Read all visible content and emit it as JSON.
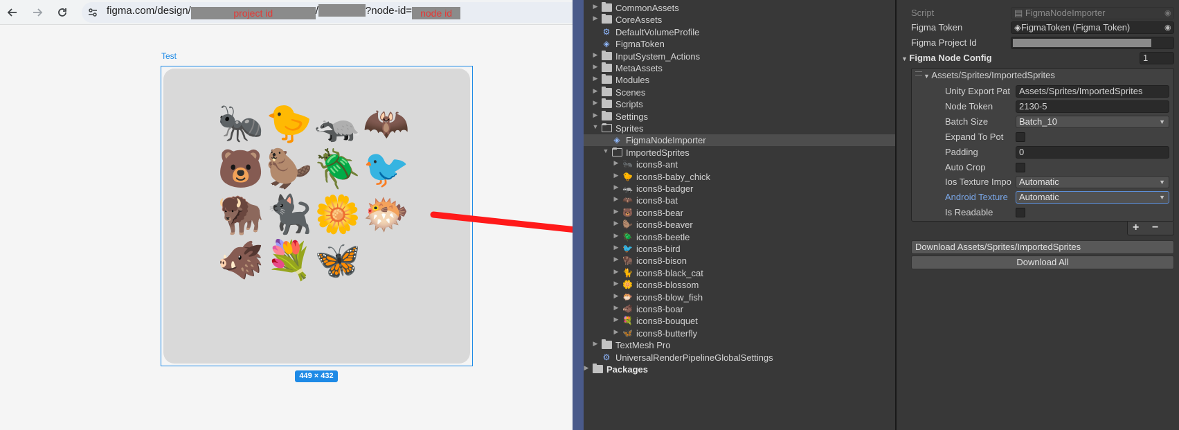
{
  "browser": {
    "url_prefix": "figma.com/design/",
    "url_project_id": "project id",
    "url_slash": "/",
    "url_query": "?node-id=",
    "url_node_id": "node id",
    "frame_label": "Test",
    "size_badge": "449 × 432",
    "emojis": [
      "🐜",
      "🐤",
      "🦡",
      "🦇",
      "🐻",
      "🦫",
      "🪲",
      "🐦",
      "🦬",
      "🐈‍⬛",
      "🌼",
      "🐡",
      "🐗",
      "💐",
      "🦋"
    ]
  },
  "tree": {
    "rows": [
      {
        "label": "CommonAssets",
        "kind": "folder",
        "depth": 1,
        "expanded": false
      },
      {
        "label": "CoreAssets",
        "kind": "folder",
        "depth": 1,
        "expanded": false
      },
      {
        "label": "DefaultVolumeProfile",
        "kind": "asset",
        "icon": "⚙",
        "depth": 1
      },
      {
        "label": "FigmaToken",
        "kind": "asset",
        "icon": "◈",
        "depth": 1
      },
      {
        "label": "InputSystem_Actions",
        "kind": "folder",
        "depth": 1,
        "expanded": false
      },
      {
        "label": "MetaAssets",
        "kind": "folder",
        "depth": 1,
        "expanded": false
      },
      {
        "label": "Modules",
        "kind": "folder",
        "depth": 1,
        "expanded": false
      },
      {
        "label": "Scenes",
        "kind": "folder",
        "depth": 1,
        "expanded": false
      },
      {
        "label": "Scripts",
        "kind": "folder",
        "depth": 1,
        "expanded": false
      },
      {
        "label": "Settings",
        "kind": "folder",
        "depth": 1,
        "expanded": false
      },
      {
        "label": "Sprites",
        "kind": "folder",
        "depth": 1,
        "expanded": true
      },
      {
        "label": "FigmaNodeImporter",
        "kind": "asset",
        "icon": "◈",
        "depth": 2,
        "selected": true
      },
      {
        "label": "ImportedSprites",
        "kind": "folder",
        "depth": 2,
        "expanded": true
      },
      {
        "label": "icons8-ant",
        "kind": "sprite",
        "icon": "🐜",
        "depth": 3
      },
      {
        "label": "icons8-baby_chick",
        "kind": "sprite",
        "icon": "🐤",
        "depth": 3
      },
      {
        "label": "icons8-badger",
        "kind": "sprite",
        "icon": "🦡",
        "depth": 3
      },
      {
        "label": "icons8-bat",
        "kind": "sprite",
        "icon": "🦇",
        "depth": 3
      },
      {
        "label": "icons8-bear",
        "kind": "sprite",
        "icon": "🐻",
        "depth": 3
      },
      {
        "label": "icons8-beaver",
        "kind": "sprite",
        "icon": "🦫",
        "depth": 3
      },
      {
        "label": "icons8-beetle",
        "kind": "sprite",
        "icon": "🪲",
        "depth": 3
      },
      {
        "label": "icons8-bird",
        "kind": "sprite",
        "icon": "🐦",
        "depth": 3
      },
      {
        "label": "icons8-bison",
        "kind": "sprite",
        "icon": "🦬",
        "depth": 3
      },
      {
        "label": "icons8-black_cat",
        "kind": "sprite",
        "icon": "🐈",
        "depth": 3
      },
      {
        "label": "icons8-blossom",
        "kind": "sprite",
        "icon": "🌼",
        "depth": 3
      },
      {
        "label": "icons8-blow_fish",
        "kind": "sprite",
        "icon": "🐡",
        "depth": 3
      },
      {
        "label": "icons8-boar",
        "kind": "sprite",
        "icon": "🐗",
        "depth": 3
      },
      {
        "label": "icons8-bouquet",
        "kind": "sprite",
        "icon": "💐",
        "depth": 3
      },
      {
        "label": "icons8-butterfly",
        "kind": "sprite",
        "icon": "🦋",
        "depth": 3
      },
      {
        "label": "TextMesh Pro",
        "kind": "folder",
        "depth": 1,
        "expanded": false
      },
      {
        "label": "UniversalRenderPipelineGlobalSettings",
        "kind": "asset",
        "icon": "⚙",
        "depth": 1
      },
      {
        "label": "Packages",
        "kind": "folder",
        "depth": 0,
        "expanded": false,
        "bold": true
      }
    ]
  },
  "inspector": {
    "script_label": "Script",
    "script_value": "FigmaNodeImporter",
    "token_label": "Figma Token",
    "token_value": "FigmaToken (Figma Token)",
    "project_label": "Figma Project Id",
    "config_label": "Figma Node Config",
    "config_count": "1",
    "element_label": "Assets/Sprites/ImportedSprites",
    "unity_export_label": "Unity Export Pat",
    "unity_export_value": "Assets/Sprites/ImportedSprites",
    "node_token_label": "Node Token",
    "node_token_value": "2130-5",
    "batch_size_label": "Batch Size",
    "batch_size_value": "Batch_10",
    "expand_label": "Expand To Pot",
    "padding_label": "Padding",
    "padding_value": "0",
    "autocrop_label": "Auto Crop",
    "ios_label": "Ios Texture Impo",
    "ios_value": "Automatic",
    "android_label": "Android Texture",
    "android_value": "Automatic",
    "readable_label": "Is Readable",
    "add_label": "+",
    "remove_label": "−",
    "download_label": "Download Assets/Sprites/ImportedSprites",
    "download_all_label": "Download All",
    "accent_color": "#7aa7e8"
  }
}
